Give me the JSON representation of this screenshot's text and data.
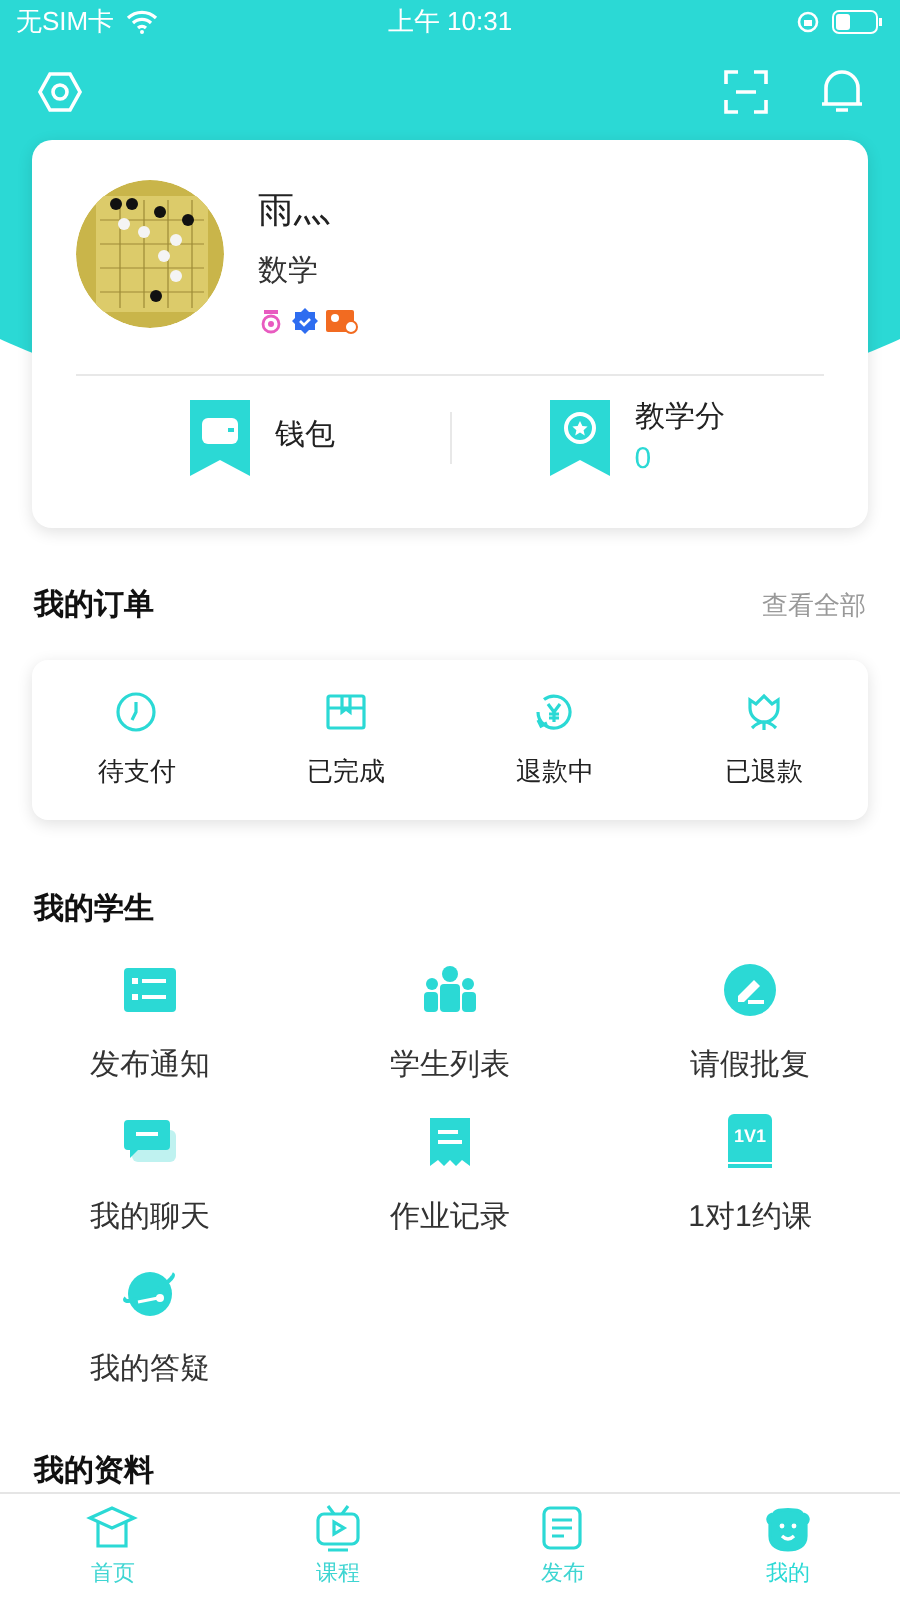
{
  "status_bar": {
    "carrier": "无SIM卡",
    "time": "上午 10:31"
  },
  "profile": {
    "name": "雨灬",
    "subject": "数学",
    "wallet": {
      "label": "钱包"
    },
    "score": {
      "label": "教学分",
      "value": "0"
    }
  },
  "orders": {
    "title": "我的订单",
    "more": "查看全部",
    "items": [
      {
        "kind": "clock",
        "label": "待支付"
      },
      {
        "kind": "box",
        "label": "已完成"
      },
      {
        "kind": "refund",
        "label": "退款中"
      },
      {
        "kind": "flower",
        "label": "已退款"
      }
    ]
  },
  "students": {
    "title": "我的学生",
    "items": [
      {
        "kind": "notice",
        "label": "发布通知"
      },
      {
        "kind": "people",
        "label": "学生列表"
      },
      {
        "kind": "edit",
        "label": "请假批复"
      },
      {
        "kind": "chat",
        "label": "我的聊天"
      },
      {
        "kind": "record",
        "label": "作业记录"
      },
      {
        "kind": "oneone",
        "label": "1对1约课",
        "icon_text": "1V1"
      },
      {
        "kind": "planet",
        "label": "我的答疑"
      }
    ]
  },
  "materials": {
    "title": "我的资料"
  },
  "tab_bar": [
    {
      "kind": "home",
      "label": "首页",
      "selected": false
    },
    {
      "kind": "tv",
      "label": "课程",
      "selected": false
    },
    {
      "kind": "doc",
      "label": "发布",
      "selected": false
    },
    {
      "kind": "me",
      "label": "我的",
      "selected": true
    }
  ]
}
